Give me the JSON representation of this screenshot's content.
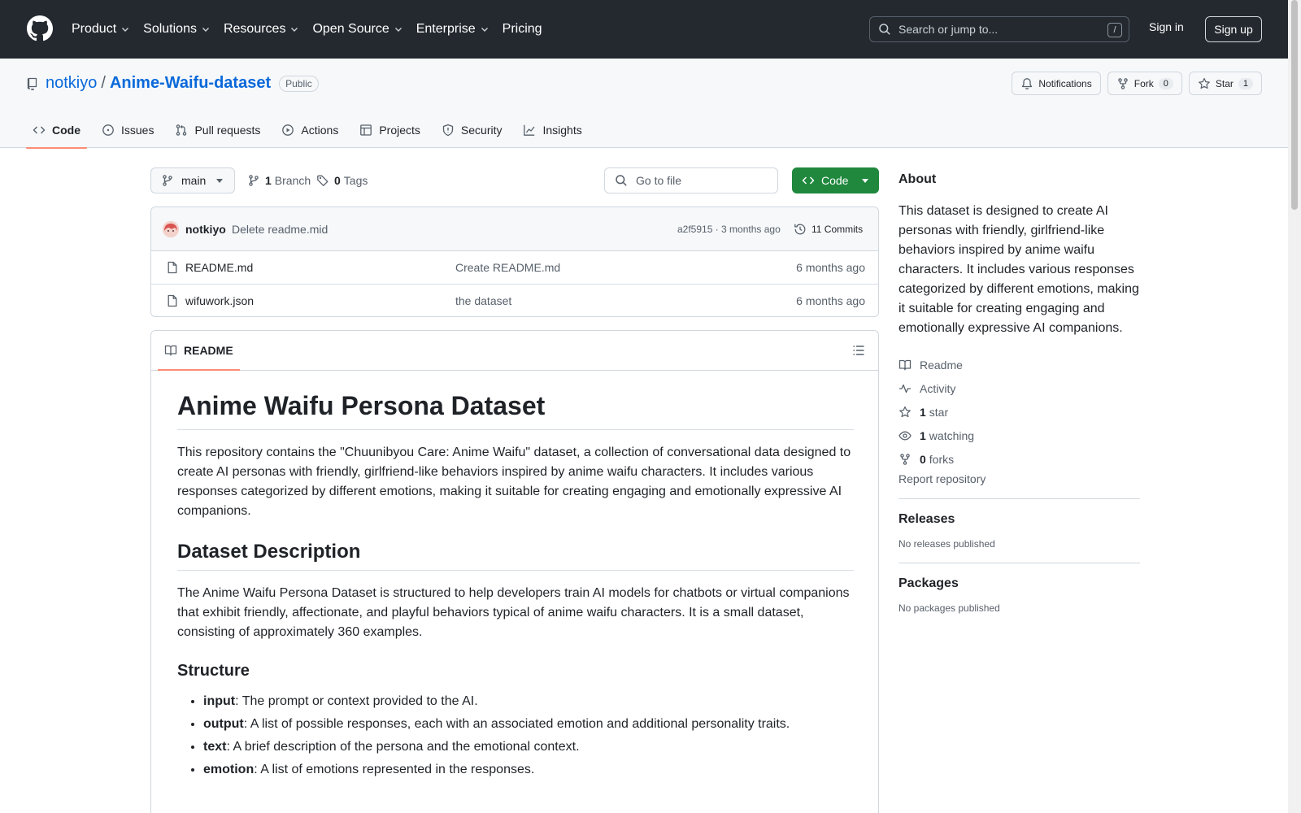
{
  "header": {
    "nav": [
      {
        "label": "Product",
        "dropdown": true
      },
      {
        "label": "Solutions",
        "dropdown": true
      },
      {
        "label": "Resources",
        "dropdown": true
      },
      {
        "label": "Open Source",
        "dropdown": true
      },
      {
        "label": "Enterprise",
        "dropdown": true
      },
      {
        "label": "Pricing",
        "dropdown": false
      }
    ],
    "search_placeholder": "Search or jump to...",
    "search_shortcut": "/",
    "sign_in": "Sign in",
    "sign_up": "Sign up"
  },
  "repo": {
    "owner": "notkiyo",
    "separator": "/",
    "name": "Anime-Waifu-dataset",
    "visibility": "Public",
    "notifications_label": "Notifications",
    "fork_label": "Fork",
    "fork_count": "0",
    "star_label": "Star",
    "star_count": "1"
  },
  "tabs": [
    {
      "label": "Code",
      "icon": "code-icon",
      "active": true
    },
    {
      "label": "Issues",
      "icon": "issue-icon",
      "active": false
    },
    {
      "label": "Pull requests",
      "icon": "pull-request-icon",
      "active": false
    },
    {
      "label": "Actions",
      "icon": "play-icon",
      "active": false
    },
    {
      "label": "Projects",
      "icon": "table-icon",
      "active": false
    },
    {
      "label": "Security",
      "icon": "shield-icon",
      "active": false
    },
    {
      "label": "Insights",
      "icon": "graph-icon",
      "active": false
    }
  ],
  "branch": {
    "name": "main",
    "branch_count": "1",
    "branch_label": "Branch",
    "tag_count": "0",
    "tag_label": "Tags",
    "go_to_file": "Go to file",
    "code_button": "Code"
  },
  "commit": {
    "author": "notkiyo",
    "message": "Delete readme.mid",
    "hash_time": "a2f5915 · 3 months ago",
    "commits": "11 Commits"
  },
  "files": [
    {
      "name": "README.md",
      "message": "Create README.md",
      "date": "6 months ago"
    },
    {
      "name": "wifuwork.json",
      "message": "the dataset",
      "date": "6 months ago"
    }
  ],
  "readme": {
    "tab_label": "README",
    "h1": "Anime Waifu Persona Dataset",
    "intro": "This repository contains the \"Chuunibyou Care: Anime Waifu\" dataset, a collection of conversational data designed to create AI personas with friendly, girlfriend-like behaviors inspired by anime waifu characters. It includes various responses categorized by different emotions, making it suitable for creating engaging and emotionally expressive AI companions.",
    "h2_description": "Dataset Description",
    "description": "The Anime Waifu Persona Dataset is structured to help developers train AI models for chatbots or virtual companions that exhibit friendly, affectionate, and playful behaviors typical of anime waifu characters. It is a small dataset, consisting of approximately 360 examples.",
    "h3_structure": "Structure",
    "structure": [
      {
        "term": "input",
        "desc": ": The prompt or context provided to the AI."
      },
      {
        "term": "output",
        "desc": ": A list of possible responses, each with an associated emotion and additional personality traits."
      },
      {
        "term": "text",
        "desc": ": A brief description of the persona and the emotional context."
      },
      {
        "term": "emotion",
        "desc": ": A list of emotions represented in the responses."
      }
    ]
  },
  "sidebar": {
    "about_title": "About",
    "about_text": "This dataset is designed to create AI personas with friendly, girlfriend-like behaviors inspired by anime waifu characters. It includes various responses categorized by different emotions, making it suitable for creating engaging and emotionally expressive AI companions.",
    "links": [
      {
        "count": "",
        "label": "Readme",
        "icon": "book-icon"
      },
      {
        "count": "",
        "label": "Activity",
        "icon": "pulse-icon"
      },
      {
        "count": "1",
        "label": "star",
        "icon": "star-icon"
      },
      {
        "count": "1",
        "label": "watching",
        "icon": "eye-icon"
      },
      {
        "count": "0",
        "label": "forks",
        "icon": "fork-icon"
      }
    ],
    "report": "Report repository",
    "releases_title": "Releases",
    "releases_text": "No releases published",
    "packages_title": "Packages",
    "packages_text": "No packages published"
  }
}
